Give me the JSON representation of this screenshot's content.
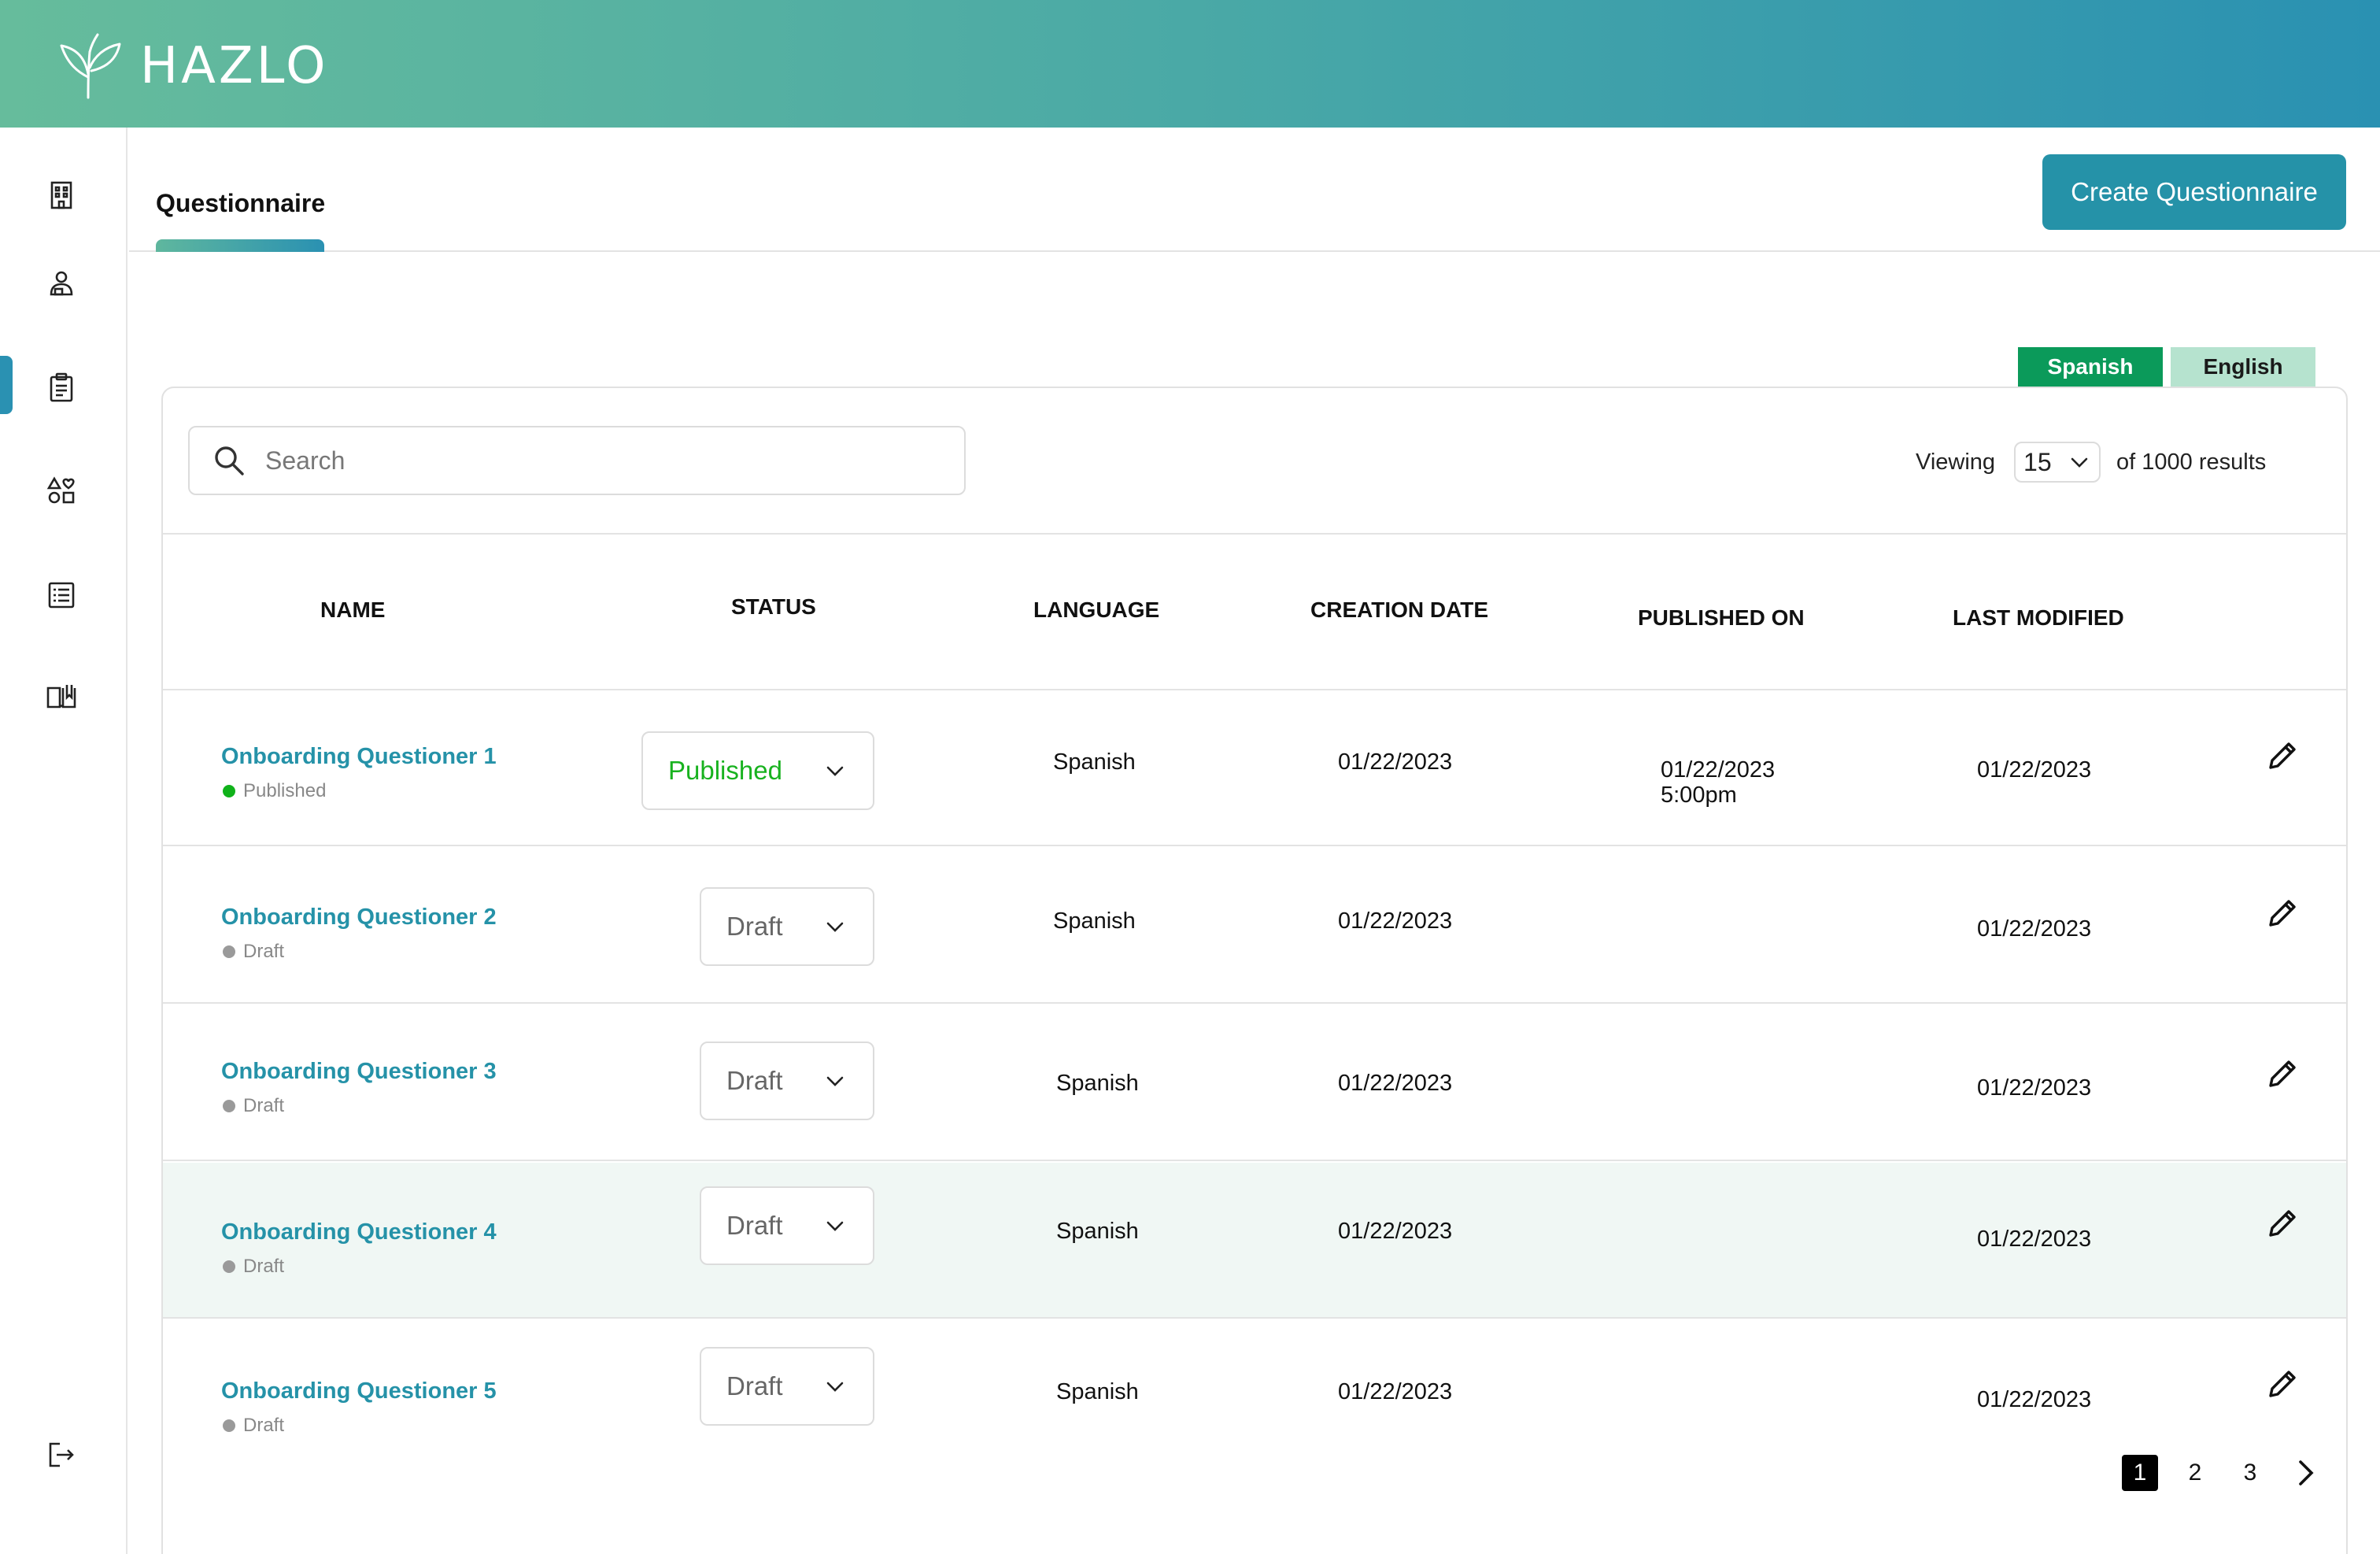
{
  "app": {
    "brand": "HAZLO"
  },
  "sidebar": {
    "items": [
      {
        "icon": "building-icon"
      },
      {
        "icon": "user-badge-icon"
      },
      {
        "icon": "clipboard-icon"
      },
      {
        "icon": "shapes-heart-icon"
      },
      {
        "icon": "list-doc-icon"
      },
      {
        "icon": "book-open-icon"
      }
    ],
    "active_index": 2,
    "logout_icon": "logout-icon"
  },
  "header": {
    "tab_label": "Questionnaire",
    "create_label": "Create Questionnaire"
  },
  "language_toggle": {
    "spanish": "Spanish",
    "english": "English",
    "selected": "Spanish"
  },
  "search": {
    "placeholder": "Search",
    "value": ""
  },
  "paging": {
    "viewing_label": "Viewing",
    "per_page": "15",
    "results_label": "of 1000 results"
  },
  "table": {
    "columns": [
      "NAME",
      "STATUS",
      "LANGUAGE",
      "CREATION DATE",
      "PUBLISHED ON",
      "LAST MODIFIED"
    ],
    "rows": [
      {
        "name": "Onboarding Questioner 1",
        "sub_status": "Published",
        "status": "Published",
        "language": "Spanish",
        "created": "01/22/2023",
        "published_date": "01/22/2023",
        "published_time": "5:00pm",
        "modified": "01/22/2023"
      },
      {
        "name": "Onboarding Questioner 2",
        "sub_status": "Draft",
        "status": "Draft",
        "language": "Spanish",
        "created": "01/22/2023",
        "published_date": "",
        "published_time": "",
        "modified": "01/22/2023"
      },
      {
        "name": "Onboarding Questioner 3",
        "sub_status": "Draft",
        "status": "Draft",
        "language": "Spanish",
        "created": "01/22/2023",
        "published_date": "",
        "published_time": "",
        "modified": "01/22/2023"
      },
      {
        "name": "Onboarding Questioner 4",
        "sub_status": "Draft",
        "status": "Draft",
        "language": "Spanish",
        "created": "01/22/2023",
        "published_date": "",
        "published_time": "",
        "modified": "01/22/2023"
      },
      {
        "name": "Onboarding Questioner 5",
        "sub_status": "Draft",
        "status": "Draft",
        "language": "Spanish",
        "created": "01/22/2023",
        "published_date": "",
        "published_time": "",
        "modified": "01/22/2023"
      }
    ]
  },
  "pagination": {
    "pages": [
      "1",
      "2",
      "3"
    ],
    "current": "1"
  },
  "colors": {
    "brand_teal": "#2592a8",
    "published_green": "#10b21a",
    "toggle_active": "#0b9a5a",
    "toggle_inactive": "#b6e3cf",
    "row_highlight": "#f0f7f4"
  }
}
